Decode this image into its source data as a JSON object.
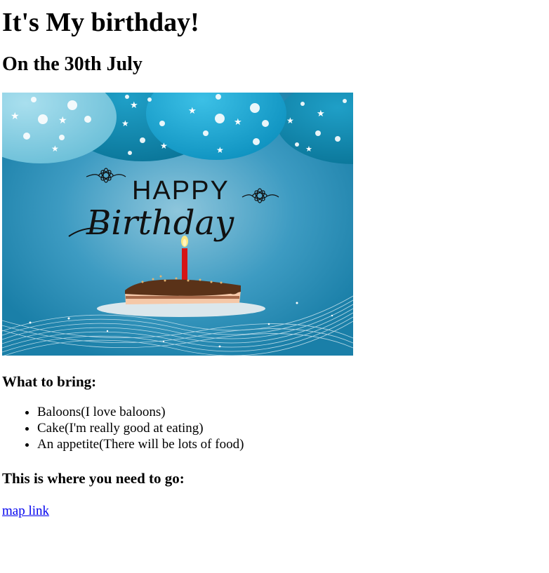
{
  "heading": "It's My birthday!",
  "date_heading": "On the 30th July",
  "image": {
    "happy_text": "HAPPY",
    "birthday_text": "Birthday"
  },
  "bring_heading": "What to bring:",
  "bring_items": [
    "Baloons(I love baloons)",
    "Cake(I'm really good at eating)",
    "An appetite(There will be lots of food)"
  ],
  "where_heading": "This is where you need to go:",
  "map_link_text": "map link",
  "colors": {
    "link": "#0000ee",
    "banner_bg": "#2a90b8",
    "balloon_light": "#8fd0e2",
    "balloon_dark": "#1186ad",
    "balloon_mid": "#1aa6d2",
    "candle": "#d61515"
  }
}
